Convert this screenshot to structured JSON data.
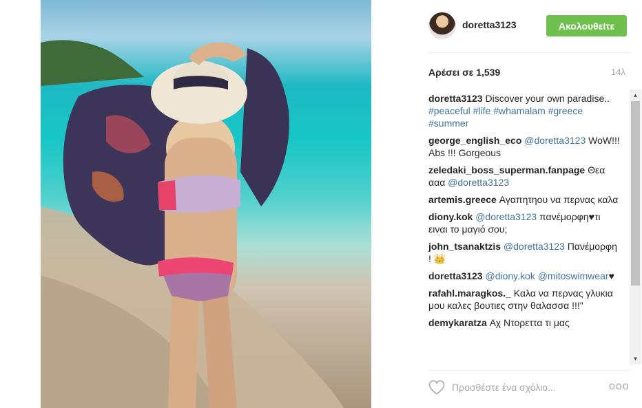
{
  "post": {
    "username": "doretta3123",
    "follow_label": "Ακολουθείτε",
    "likes_label": "Αρέσει σε 1,539",
    "age": "14λ"
  },
  "comments": [
    {
      "user": "doretta3123",
      "parts": [
        {
          "t": "text",
          "v": " Discover your own paradise.. "
        },
        {
          "t": "tag",
          "v": "#peaceful"
        },
        {
          "t": "text",
          "v": " "
        },
        {
          "t": "tag",
          "v": "#life"
        },
        {
          "t": "text",
          "v": " "
        },
        {
          "t": "tag",
          "v": "#whamalam"
        },
        {
          "t": "text",
          "v": " "
        },
        {
          "t": "tag",
          "v": "#greece"
        },
        {
          "t": "text",
          "v": " "
        },
        {
          "t": "tag",
          "v": "#summer"
        }
      ]
    },
    {
      "user": "george_english_eco",
      "parts": [
        {
          "t": "text",
          "v": " "
        },
        {
          "t": "mention",
          "v": "@doretta3123"
        },
        {
          "t": "text",
          "v": " WoW!!! Abs !!! Gorgeous"
        }
      ]
    },
    {
      "user": "zeledaki_boss_superman.fanpage",
      "parts": [
        {
          "t": "text",
          "v": " Θεα ααα "
        },
        {
          "t": "mention",
          "v": "@doretta3123"
        }
      ]
    },
    {
      "user": "artemis.greece",
      "parts": [
        {
          "t": "text",
          "v": " Αγαπητηου να περνας καλα"
        }
      ]
    },
    {
      "user": "diony.kok",
      "parts": [
        {
          "t": "text",
          "v": " "
        },
        {
          "t": "mention",
          "v": "@doretta3123"
        },
        {
          "t": "text",
          "v": " πανέμορφη♥τι ειναι το μαγιό σου;"
        }
      ]
    },
    {
      "user": "john_tsanaktzis",
      "parts": [
        {
          "t": "text",
          "v": " "
        },
        {
          "t": "mention",
          "v": "@doretta3123"
        },
        {
          "t": "text",
          "v": " Πανέμορφη ! 👑"
        }
      ]
    },
    {
      "user": "doretta3123",
      "parts": [
        {
          "t": "text",
          "v": " "
        },
        {
          "t": "mention",
          "v": "@diony.kok"
        },
        {
          "t": "text",
          "v": " "
        },
        {
          "t": "mention",
          "v": "@mitoswimwear"
        },
        {
          "t": "text",
          "v": "♥"
        }
      ]
    },
    {
      "user": "rafahl.maragkos._",
      "parts": [
        {
          "t": "text",
          "v": " Καλα να περνας γλυκια μου καλες βουτιες στην θαλασσα !!!\""
        }
      ]
    },
    {
      "user": "demykaratza",
      "parts": [
        {
          "t": "text",
          "v": " Αχ Ντορεττα τι μας"
        }
      ]
    }
  ],
  "footer": {
    "comment_placeholder": "Προσθέστε ένα σχόλιο...",
    "more_label": "ooo"
  },
  "icons": {
    "like": "heart-outline-icon",
    "more": "more-options-icon",
    "scroll_up": "scroll-up-icon",
    "scroll_down": "scroll-down-icon"
  },
  "colors": {
    "follow": "#70c050",
    "link": "#3f729b",
    "muted": "#a5a7aa"
  }
}
